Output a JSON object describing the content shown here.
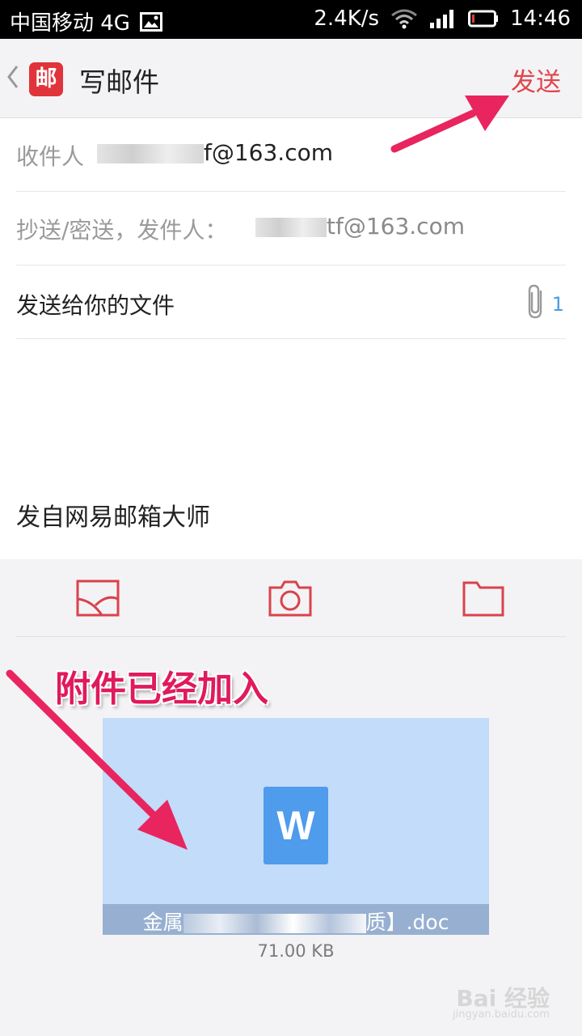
{
  "status_bar": {
    "carrier": "中国移动 4G",
    "speed": "2.4K/s",
    "time": "14:46",
    "icons": [
      "image-icon",
      "wifi-icon",
      "signal-icon",
      "battery-icon"
    ]
  },
  "title_bar": {
    "app_logo_char": "邮",
    "title": "写邮件",
    "send_label": "发送"
  },
  "form": {
    "to_label": "收件人",
    "to_value": "f@163.com",
    "cc_label": "抄送/密送，发件人：",
    "cc_value": "tf@163.com",
    "subject": "发送给你的文件",
    "attachment_count": "1",
    "signature": "发自网易邮箱大师"
  },
  "toolbar": {
    "items": [
      "image-icon",
      "camera-icon",
      "folder-icon"
    ]
  },
  "annotation": {
    "text": "附件已经加入"
  },
  "attachment": {
    "icon_letter": "W",
    "name_start": "金属",
    "name_end": "质】.doc",
    "size": "71.00 KB"
  },
  "watermark": {
    "text": "Bai 经验",
    "sub": "jingyan.baidu.com"
  },
  "colors": {
    "accent": "#e0454d",
    "arrow": "#e8255f",
    "attachment_bg": "#c2dcf9",
    "word_blue": "#4f9bec"
  }
}
